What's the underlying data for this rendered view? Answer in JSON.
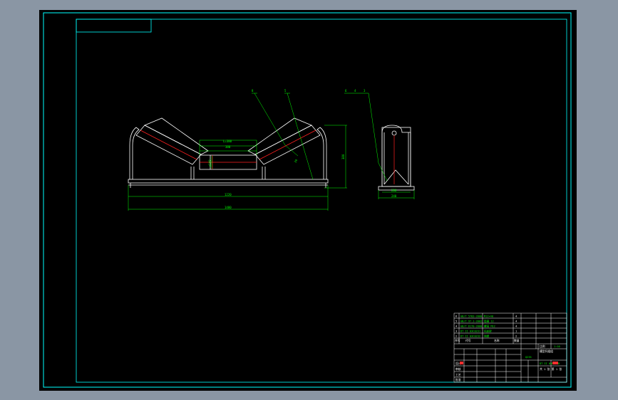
{
  "colors": {
    "sheet_background": "#000000",
    "desktop_background": "#8a96a4",
    "frame": "#00ffff",
    "geometry": "#ffffff",
    "dimension": "#00ff00",
    "center_line": "#ff0000",
    "title_block_red": "#ff3030"
  },
  "front_view": {
    "callouts": [
      "8",
      "5"
    ],
    "dimensions": {
      "roller_length": "L=380",
      "inner_span": "380",
      "roller_diameter": "ø108",
      "offset": "20",
      "height": "380",
      "inner_width": "1220",
      "overall_width": "1480"
    }
  },
  "side_view": {
    "callouts": [
      "6",
      "4",
      "3"
    ],
    "dimensions": {
      "base_inner": "200",
      "base_outer": "240"
    }
  },
  "title_block": {
    "parts_list": [
      {
        "no": "6",
        "code": "GB/T 5783-2000",
        "name": "M12×40",
        "qty": "4"
      },
      {
        "no": "5",
        "code": "GB/T 97.1-2002",
        "name": "垫圈 12",
        "qty": "4"
      },
      {
        "no": "4",
        "code": "GB/T 6170-2000",
        "name": "螺母 M12",
        "qty": "4"
      },
      {
        "no": "3",
        "code": "DT II 03C0231",
        "name": "托轮架",
        "qty": "1"
      },
      {
        "no": "2",
        "code": "DT II 03C0232",
        "name": "侧辊",
        "qty": "2"
      }
    ],
    "header_labels": [
      "序号",
      "代号",
      "名称",
      "数量"
    ],
    "drawing_title": "槽型托辊组",
    "drawing_number": "DT II 04C0208",
    "scale_label": "比例",
    "scale": "1:10",
    "sheet_info": "共 1 张 第 1 张",
    "material": "Q235",
    "signatures": [
      "设计",
      "审核",
      "工艺",
      "批准"
    ]
  }
}
